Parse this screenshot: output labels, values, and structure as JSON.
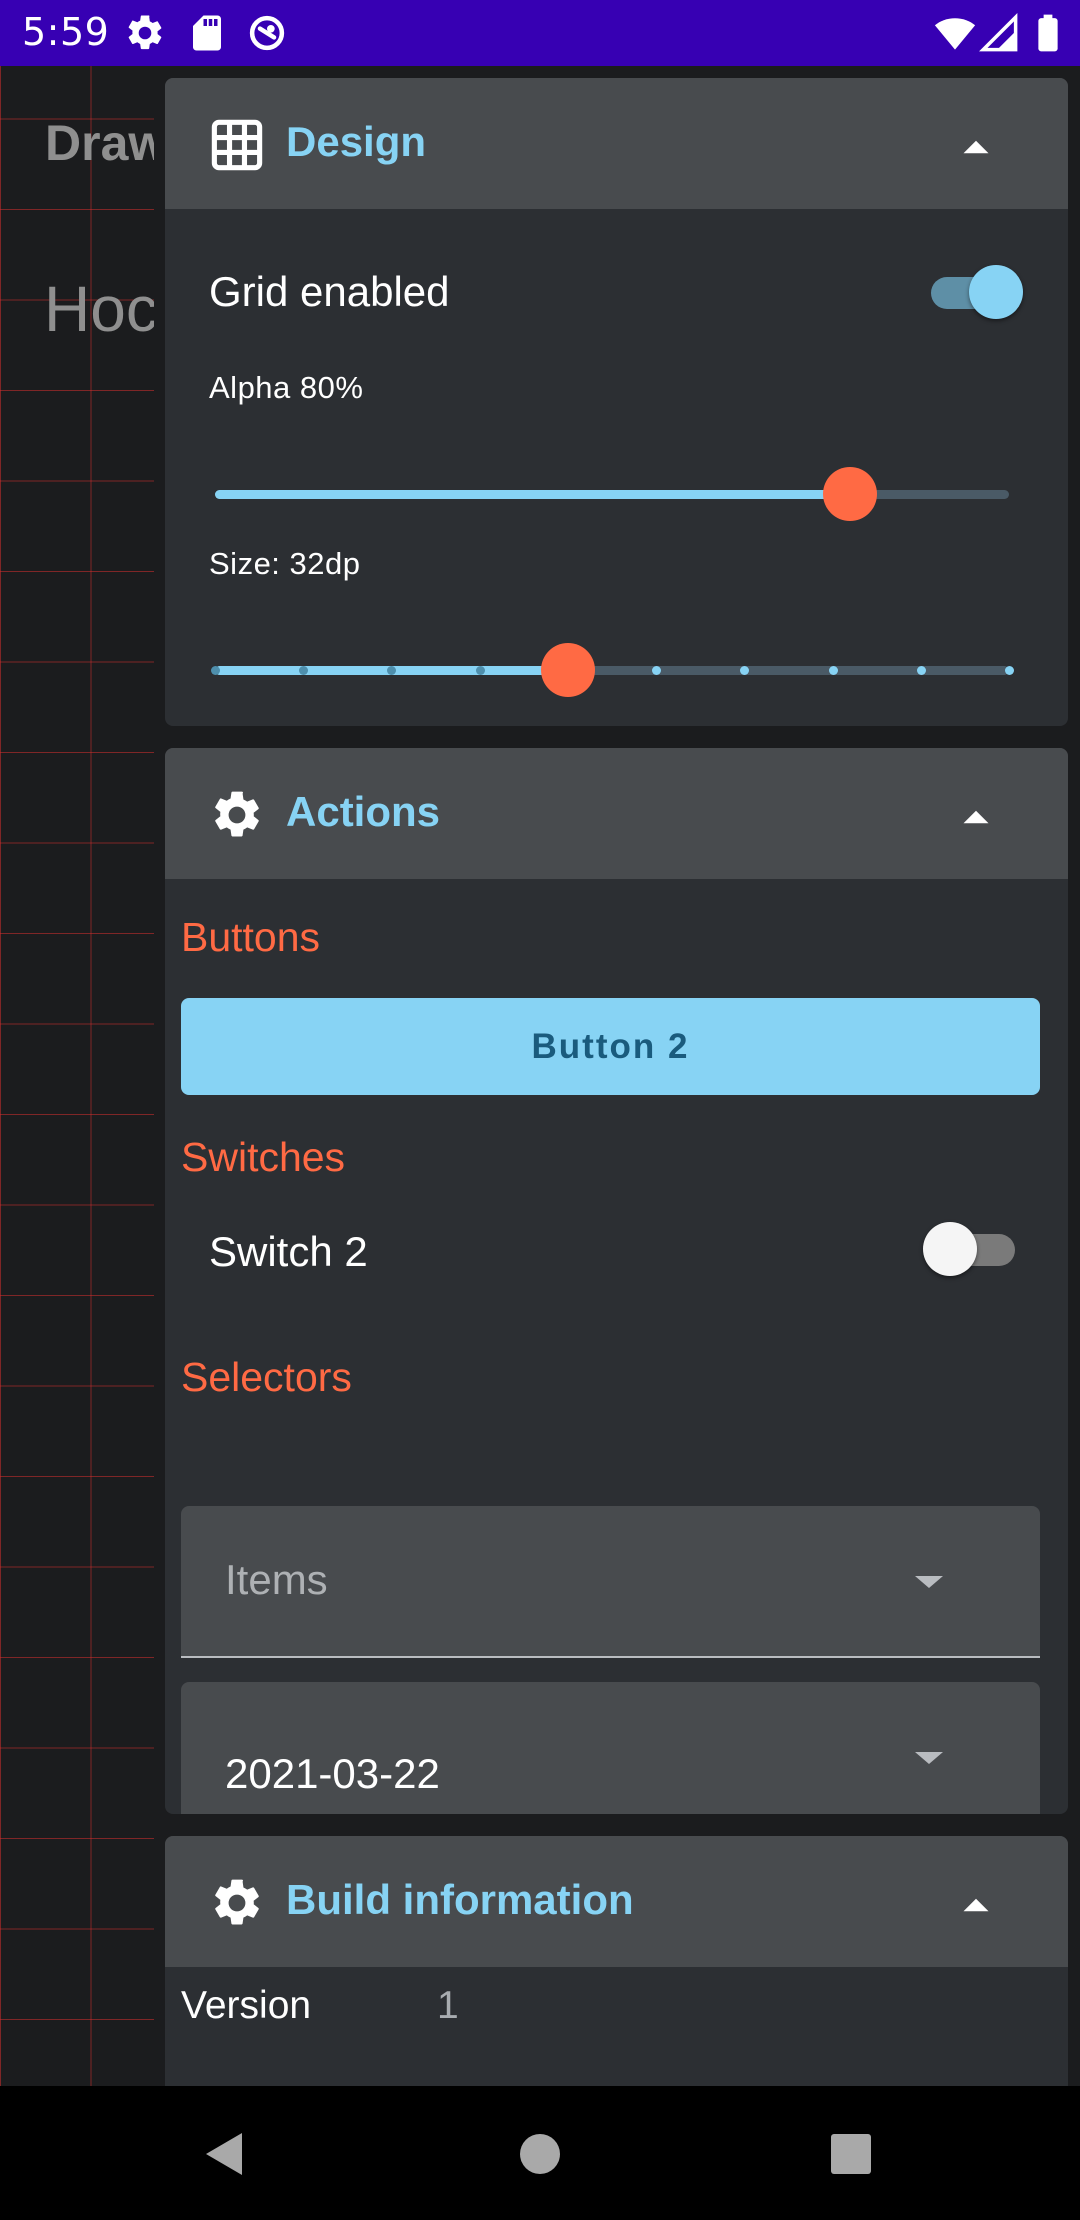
{
  "status_bar": {
    "time": "5:59",
    "icons": [
      "gear-icon",
      "sd-card-icon",
      "sync-icon",
      "wifi-icon",
      "signal-icon",
      "battery-icon"
    ]
  },
  "background_app": {
    "title": "Draw",
    "subtitle": "Hoc"
  },
  "design": {
    "title": "Design",
    "icon": "grid-icon",
    "grid_label": "Grid enabled",
    "grid_enabled": true,
    "alpha_label": "Alpha 80%",
    "alpha_value": 0.8,
    "size_label": "Size: 32dp",
    "size_steps": 10,
    "size_index": 4
  },
  "actions": {
    "title": "Actions",
    "icon": "gear-icon",
    "buttons_label": "Buttons",
    "button_2_label": "Button 2",
    "switches_label": "Switches",
    "switch_2_label": "Switch 2",
    "switch_2_on": false,
    "selectors_label": "Selectors",
    "items_select": "Items",
    "date_select": "2021-03-22"
  },
  "build_info": {
    "title": "Build information",
    "icon": "gear-icon",
    "version_label": "Version",
    "version_value": "1"
  },
  "colors": {
    "accent": "#87d3f4",
    "section": "#ff6a44",
    "status_bar": "#3700b3",
    "panel": "#2c2f33",
    "panel_header": "#484b4e"
  },
  "nav_bar": {
    "buttons": [
      "back-icon",
      "home-icon",
      "recents-icon"
    ]
  }
}
